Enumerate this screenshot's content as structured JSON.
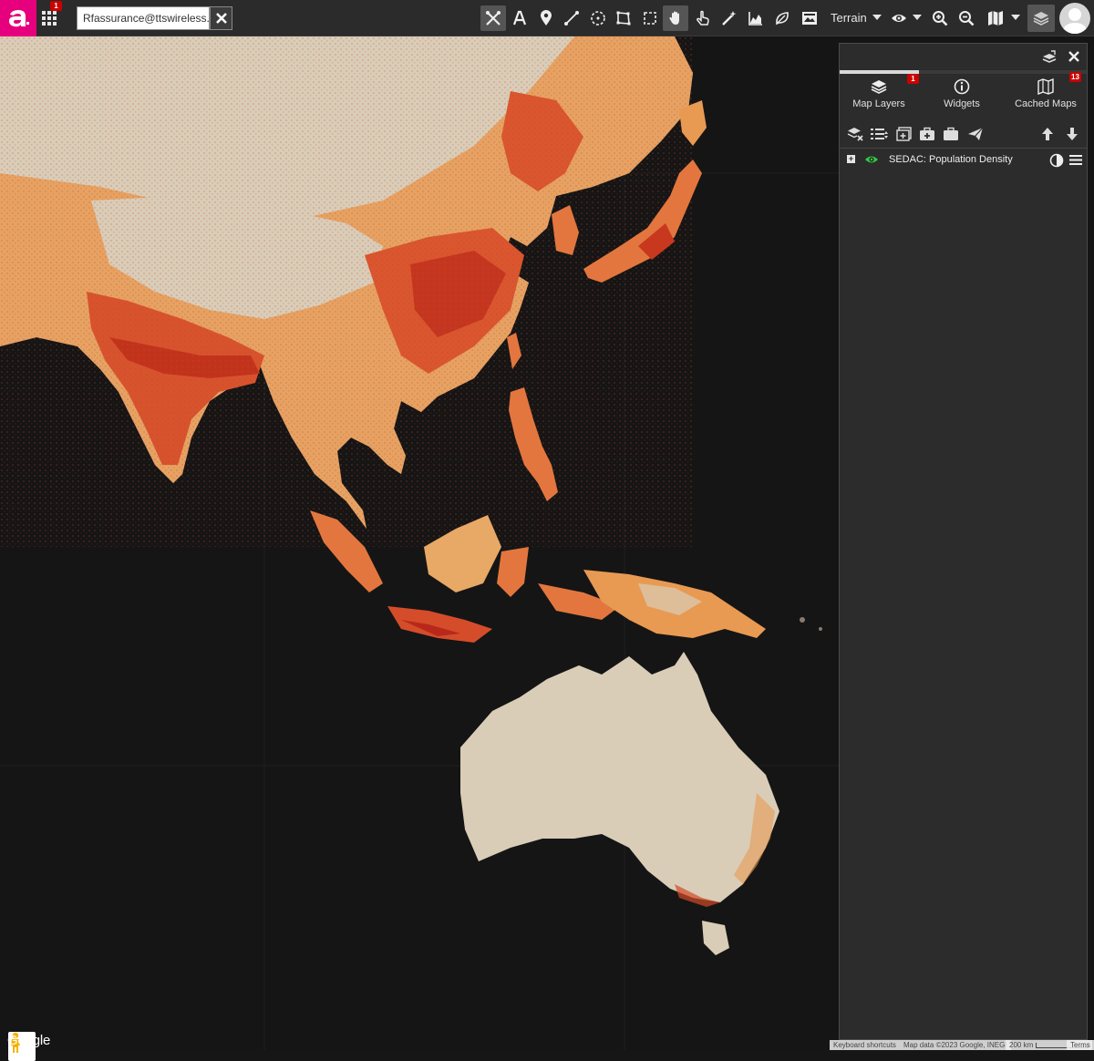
{
  "toolbar": {
    "apps_badge": "1",
    "account_email": "Rfassurance@ttswireless.co",
    "basemap_label": "Terrain",
    "tools": [
      "tools-icon",
      "text-icon",
      "marker-icon",
      "line-icon",
      "circle-icon",
      "polygon-icon",
      "rectangle-icon",
      "pan-hand-icon",
      "select-hand-icon",
      "magic-wand-icon",
      "elevation-profile-icon",
      "leaf-icon",
      "image-overlay-icon"
    ]
  },
  "panel": {
    "progress": 0.32,
    "tabs": [
      {
        "label": "Map Layers",
        "badge": "1"
      },
      {
        "label": "Widgets",
        "badge": ""
      },
      {
        "label": "Cached Maps",
        "badge": "13"
      }
    ],
    "layers": [
      {
        "name": "SEDAC: Population Density",
        "visible": true
      }
    ]
  },
  "map": {
    "google_label": "Google",
    "keyboard_shortcuts": "Keyboard shortcuts",
    "map_data": "Map data ©2023 Google, INEGI",
    "scale": "200 km",
    "terms": "Terms"
  },
  "colors": {
    "brand": "#e6007e",
    "low_density": "#d9cdb8",
    "mid_density": "#e89a52",
    "high_density": "#c8321e",
    "ocean": "#151515",
    "visible_eye": "#2ecc40"
  }
}
